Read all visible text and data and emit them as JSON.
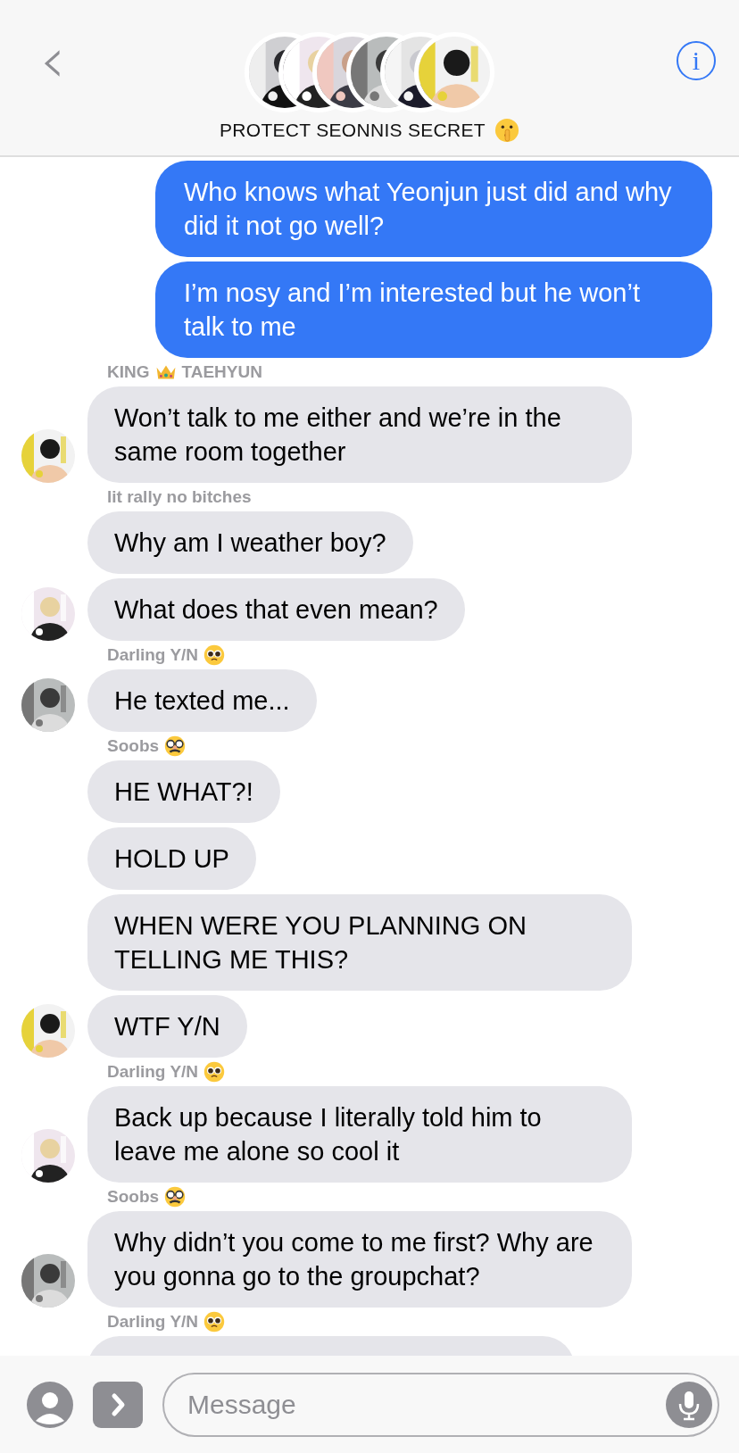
{
  "header": {
    "back": "‹",
    "title": [
      {
        "kind": "text",
        "text": "PROTECT SEONNIS SECRET"
      },
      {
        "kind": "shush"
      }
    ],
    "info": "i"
  },
  "messages": [
    {
      "kind": "sent",
      "lines": [
        "Who knows what Yeonjun just did and why did it not go well?"
      ]
    },
    {
      "kind": "sent",
      "lines": [
        "I’m nosy and I’m interested but he won’t talk to me"
      ]
    },
    {
      "kind": "received",
      "name": [
        {
          "kind": "text",
          "text": "KING"
        },
        {
          "kind": "crown"
        },
        {
          "kind": "text",
          "text": "TAEHYUN"
        }
      ],
      "lines": [
        "Won’t talk to me either and we’re in the same room together"
      ]
    },
    {
      "kind": "received",
      "name": [
        {
          "kind": "text",
          "text": "lit rally no bitches"
        }
      ],
      "lines": [
        "Why am I weather boy?",
        "What does that even mean?"
      ]
    },
    {
      "kind": "received",
      "name": [
        {
          "kind": "text",
          "text": "Darling Y/N"
        },
        {
          "kind": "pleading"
        }
      ],
      "lines": [
        "He texted me..."
      ]
    },
    {
      "kind": "received",
      "name": [
        {
          "kind": "text",
          "text": "Soobs"
        },
        {
          "kind": "disguise"
        }
      ],
      "lines": [
        "HE WHAT?!",
        "HOLD UP",
        "WHEN WERE YOU PLANNING ON TELLING ME THIS?",
        "WTF Y/N"
      ]
    },
    {
      "kind": "received",
      "name": [
        {
          "kind": "text",
          "text": "Darling Y/N"
        },
        {
          "kind": "pleading"
        }
      ],
      "lines": [
        "Back up because I literally told him to leave me alone so cool it"
      ]
    },
    {
      "kind": "received",
      "name": [
        {
          "kind": "text",
          "text": "Soobs"
        },
        {
          "kind": "disguise"
        }
      ],
      "lines": [
        "Why didn’t you come to me first? Why are you gonna go to the groupchat?"
      ]
    },
    {
      "kind": "covered",
      "name": [
        {
          "kind": "text",
          "text": "Darling Y/N"
        },
        {
          "kind": "pleading"
        }
      ]
    }
  ],
  "composer": {
    "placeholder": "Message"
  }
}
